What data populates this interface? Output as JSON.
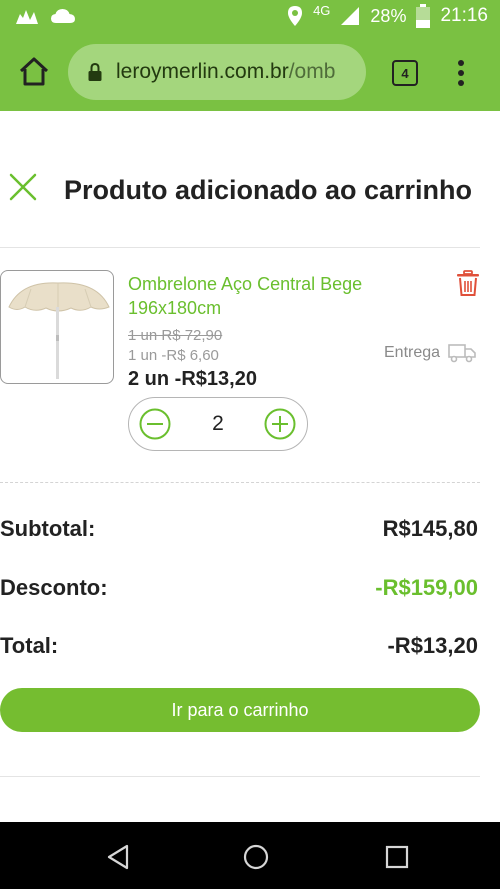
{
  "status_bar": {
    "network": "4G",
    "battery": "28%",
    "time": "21:16"
  },
  "browser": {
    "url_domain": "leroymerlin.com.br",
    "url_path": "/omb",
    "tab_count": "4"
  },
  "modal": {
    "title": "Produto adicionado ao carrinho"
  },
  "product": {
    "name": "Ombrelone Aço Central Bege 196x180cm",
    "old_price": "1 un R$ 72,90",
    "unit_discount": "1 un -R$ 6,60",
    "delivery_label": "Entrega",
    "line_total": "2 un -R$13,20",
    "quantity": "2"
  },
  "summary": {
    "subtotal_label": "Subtotal:",
    "subtotal_value": "R$145,80",
    "discount_label": "Desconto:",
    "discount_value": "-R$159,00",
    "total_label": "Total:",
    "total_value": "-R$13,20"
  },
  "actions": {
    "go_to_cart": "Ir para o carrinho"
  },
  "colors": {
    "brand_green": "#7ac142",
    "accent_green": "#6abf2e",
    "delete_red": "#e0503a"
  },
  "icons": [
    "signal-icon",
    "cloud-icon",
    "location-icon",
    "battery-icon",
    "home-icon",
    "lock-icon",
    "tabs-icon",
    "overflow-menu-icon",
    "close-icon",
    "trash-icon",
    "truck-icon",
    "minus-icon",
    "plus-icon",
    "back-icon",
    "home-nav-icon",
    "recents-icon"
  ]
}
